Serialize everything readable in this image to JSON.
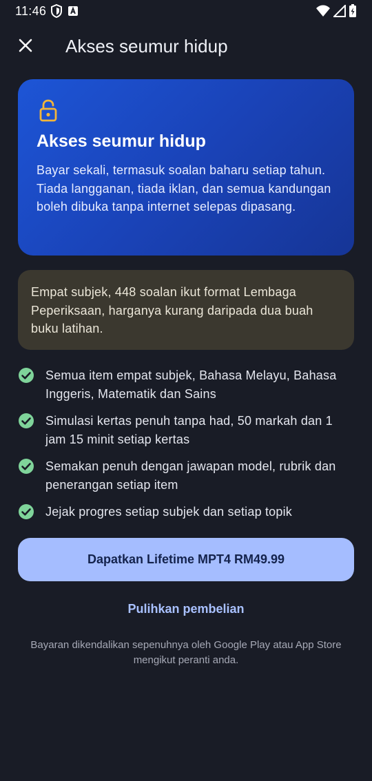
{
  "status_bar": {
    "time": "11:46",
    "icons": [
      "shield-icon",
      "font-a-icon",
      "wifi-icon",
      "signal-icon",
      "battery-icon"
    ]
  },
  "app_bar": {
    "close_icon": "close-icon",
    "title": "Akses seumur hidup"
  },
  "hero": {
    "icon": "lock-open-icon",
    "title": "Akses seumur hidup",
    "description": "Bayar sekali, termasuk soalan baharu setiap tahun. Tiada langganan, tiada iklan, dan semua kandungan boleh dibuka tanpa internet selepas dipasang."
  },
  "note": {
    "text": "Empat subjek, 448 soalan ikut format Lembaga Peperiksaan, harganya kurang daripada dua buah buku latihan."
  },
  "features": [
    "Semua item empat subjek, Bahasa Melayu, Bahasa Inggeris, Matematik dan Sains",
    "Simulasi kertas penuh tanpa had, 50 markah dan 1 jam 15 minit setiap kertas",
    "Semakan penuh dengan jawapan model, rubrik dan penerangan setiap item",
    "Jejak progres setiap subjek dan setiap topik"
  ],
  "buy_button": {
    "label": "Dapatkan Lifetime MPT4 RM49.99"
  },
  "restore_link": {
    "label": "Pulihkan pembelian"
  },
  "footnote": {
    "text": "Bayaran dikendalikan sepenuhnya oleh Google Play atau App Store mengikut peranti anda."
  },
  "colors": {
    "background": "#191c26",
    "hero_start": "#1d55d6",
    "hero_end": "#163596",
    "lock": "#f2b53a",
    "note_bg": "#3b382f",
    "check": "#7fd49a",
    "button_bg": "#a5bdff",
    "button_text": "#14234d",
    "link": "#a9c1ff"
  }
}
